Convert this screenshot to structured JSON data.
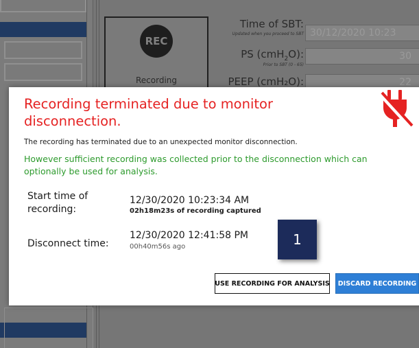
{
  "background": {
    "rec_card": {
      "icon_text": "REC",
      "label": "Recording"
    },
    "form": {
      "sbt_time": {
        "label": "Time of SBT:",
        "hint": "Updated when you proceed to SBT",
        "value": "30/12/2020 10:23"
      },
      "ps": {
        "label_main": "PS (cmH",
        "label_sub": "2",
        "label_end": "O):",
        "hint": "Prior to SBT (0 - 65)",
        "value": "30"
      },
      "peep": {
        "label": "PEEP (cmH₂O):",
        "value": "22"
      }
    }
  },
  "modal": {
    "title": "Recording terminated due to monitor disconnection.",
    "message": "The recording has terminated due to an unexpected monitor disconnection.",
    "notice": "However sufficient recording was collected prior to the disconnection which can optionally be used for analysis.",
    "start": {
      "label": "Start time of recording:",
      "value": "12/30/2020 10:23:34 AM",
      "sub": "02h18m23s of recording captured"
    },
    "disconnect": {
      "label": "Disconnect time:",
      "value": "12/30/2020 12:41:58 PM",
      "sub": "00h40m56s ago"
    },
    "badge": "1",
    "buttons": {
      "use": "USE RECORDING FOR ANALYSIS",
      "discard": "DISCARD RECORDING"
    },
    "icon": "unplugged-power-icon",
    "colors": {
      "title": "#e52222",
      "notice": "#2c9a2c",
      "primary": "#2e7fd6",
      "badge": "#1c2b5a"
    }
  }
}
